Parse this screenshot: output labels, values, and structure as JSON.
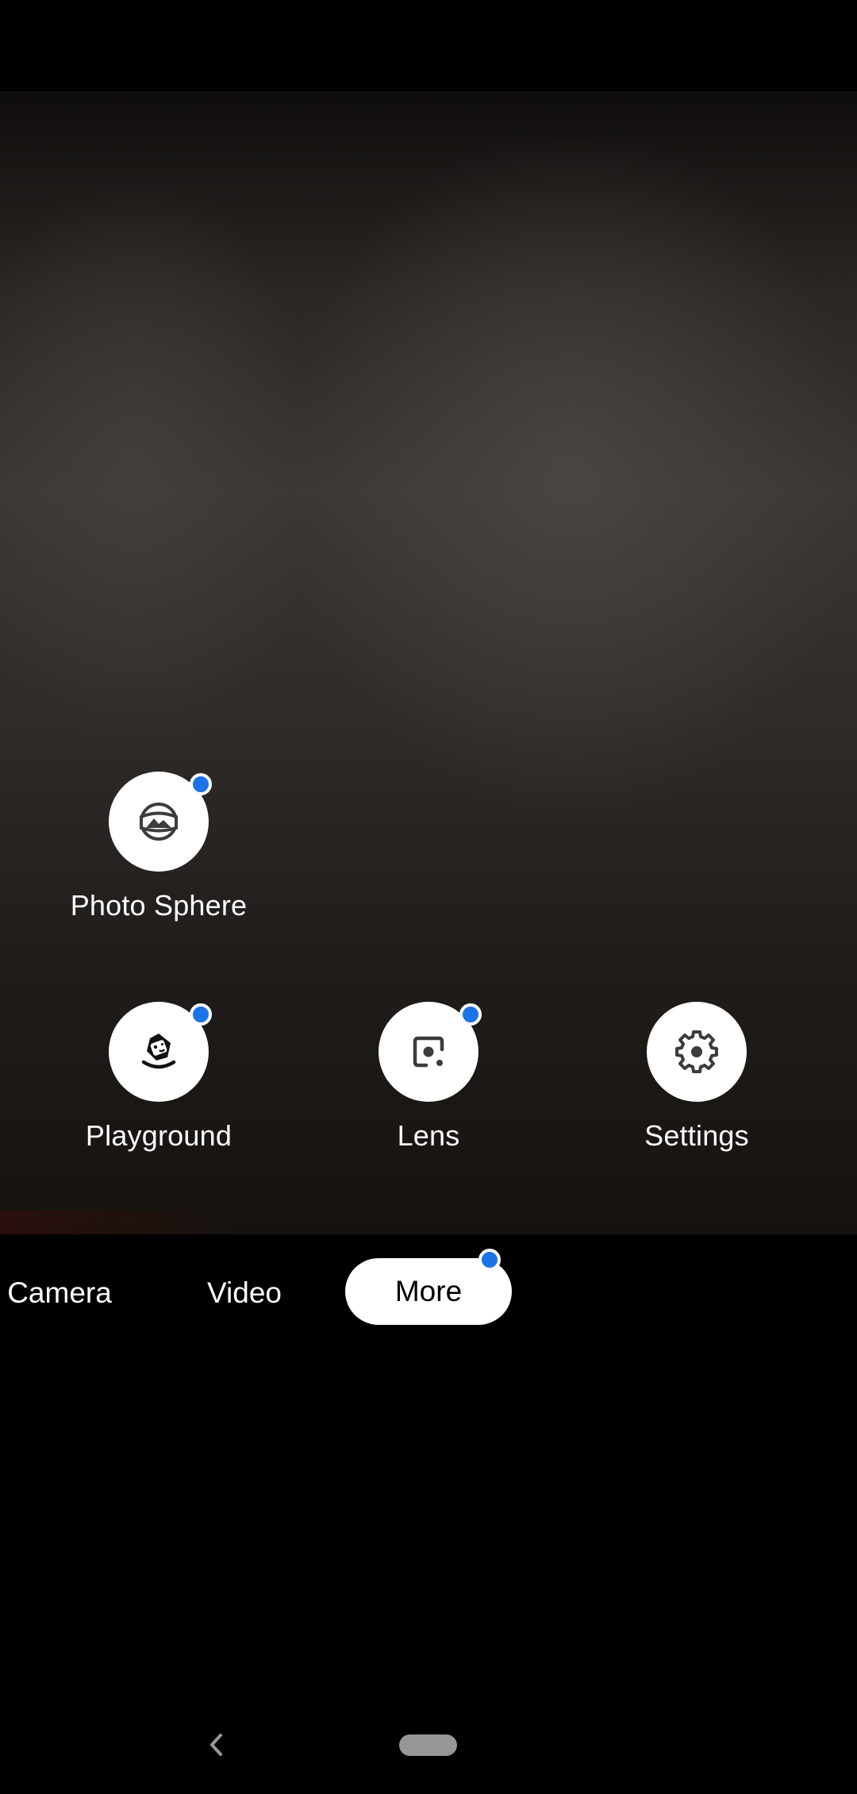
{
  "app": "Camera",
  "more_menu": {
    "items": [
      {
        "id": "photo-sphere",
        "label": "Photo Sphere",
        "icon": "photo-sphere-icon",
        "has_new_badge": true
      },
      {
        "id": "playground",
        "label": "Playground",
        "icon": "playground-icon",
        "has_new_badge": true
      },
      {
        "id": "lens",
        "label": "Lens",
        "icon": "lens-icon",
        "has_new_badge": true
      },
      {
        "id": "settings",
        "label": "Settings",
        "icon": "gear-icon",
        "has_new_badge": false
      }
    ]
  },
  "modes": {
    "tabs": [
      {
        "label": "Camera",
        "selected": false
      },
      {
        "label": "Video",
        "selected": false
      },
      {
        "label": "More",
        "selected": true,
        "has_new_badge": true
      }
    ]
  },
  "navigation": {
    "back": "back-icon",
    "home": "home-pill"
  },
  "colors": {
    "badge": "#1a73e8",
    "icon": "#3c3c3c",
    "button_bg": "#ffffff",
    "background": "#000000"
  }
}
